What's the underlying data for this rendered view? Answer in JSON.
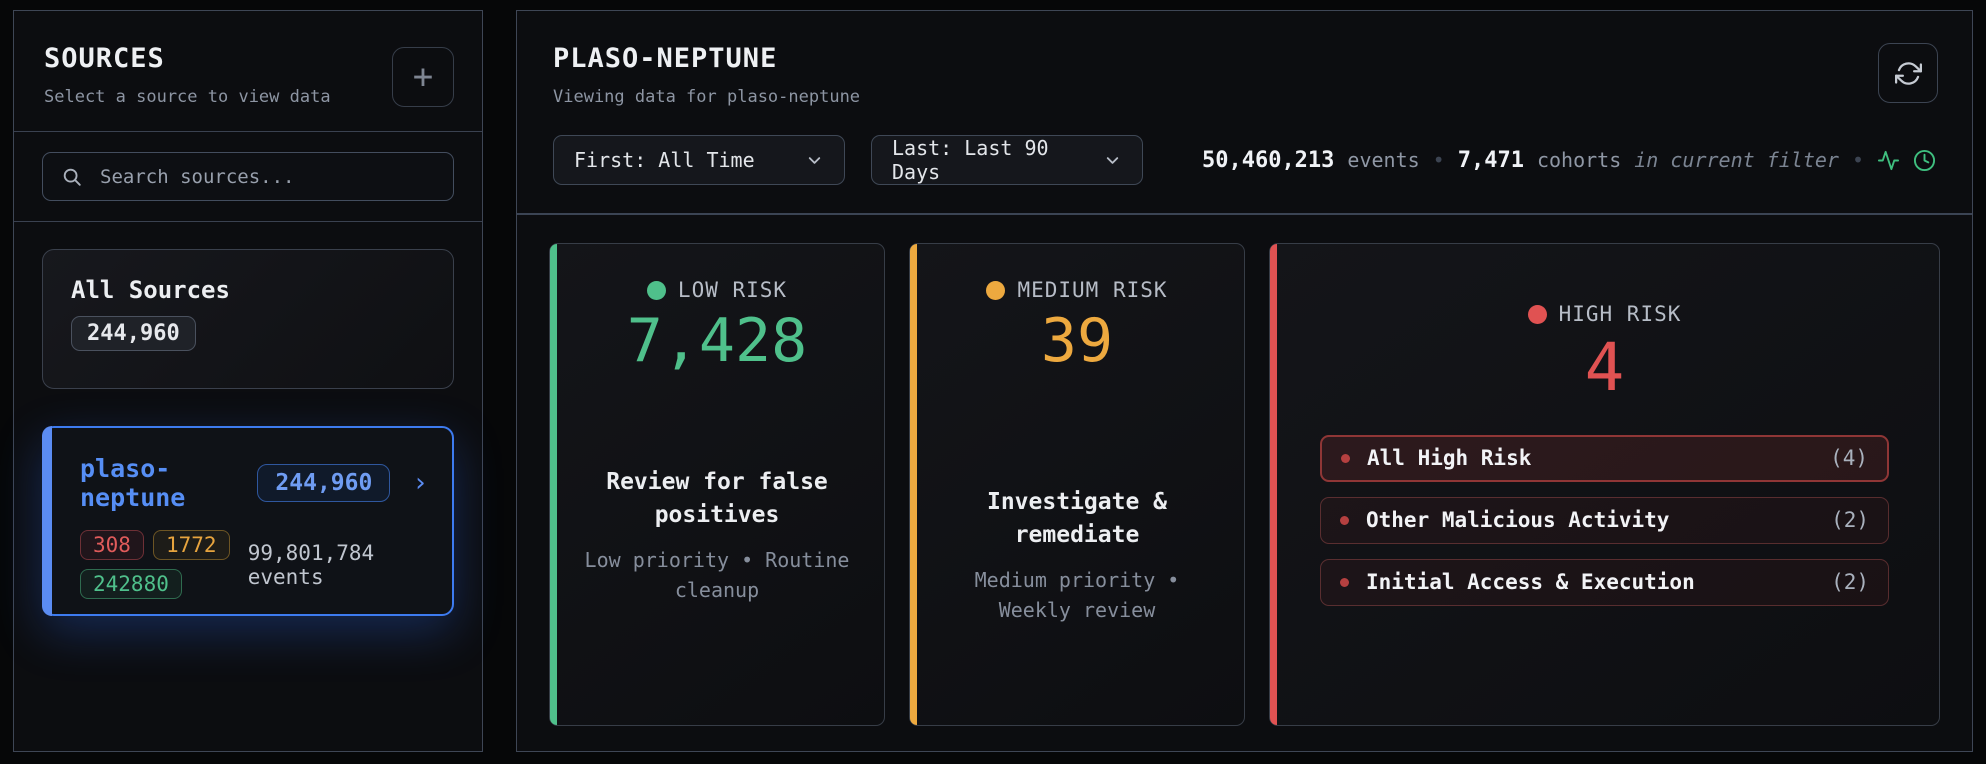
{
  "sources_panel": {
    "title": "SOURCES",
    "subtitle": "Select a source to view data",
    "add_button": "+",
    "search_placeholder": "Search sources...",
    "all_sources": {
      "label": "All Sources",
      "count": "244,960"
    },
    "selected_source": {
      "name": "plaso-neptune",
      "count": "244,960",
      "chevron": "›",
      "badges": [
        {
          "value": "308",
          "color": "#e05b5b"
        },
        {
          "value": "1772",
          "color": "#e7a43e"
        },
        {
          "value": "242880",
          "color": "#4fc08b"
        }
      ],
      "events": "99,801,784 events"
    }
  },
  "main_panel": {
    "title": "PLASO-NEPTUNE",
    "subtitle": "Viewing data for plaso-neptune",
    "filters": {
      "first": "First: All Time",
      "last": "Last: Last 90 Days"
    },
    "stats": {
      "events_value": "50,460,213",
      "events_label": "events",
      "separator": "•",
      "cohorts_value": "7,471",
      "cohorts_label": "cohorts",
      "scope": "in current filter"
    },
    "risk_cards": [
      {
        "label": "LOW RISK",
        "value": "7,428",
        "action": "Review for false positives",
        "detail": "Low priority • Routine cleanup",
        "color": "#4fc08b"
      },
      {
        "label": "MEDIUM RISK",
        "value": "39",
        "action": "Investigate & remediate",
        "detail": "Medium priority • Weekly review",
        "color": "#eda93f"
      },
      {
        "label": "HIGH RISK",
        "value": "4",
        "color": "#e05252",
        "items": [
          {
            "label": "All High Risk",
            "count": "(4)"
          },
          {
            "label": "Other Malicious Activity",
            "count": "(2)"
          },
          {
            "label": "Initial Access & Execution",
            "count": "(2)"
          }
        ]
      }
    ]
  }
}
